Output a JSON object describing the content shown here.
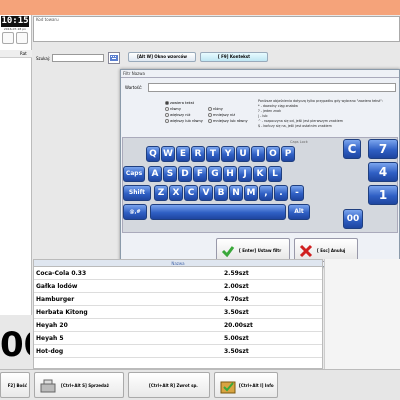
{
  "clock": {
    "time": "10:15",
    "date": "2016-07-18 pn"
  },
  "left_panel": {
    "header_label": "Rat",
    "total_display": "00"
  },
  "kod_towaru_label": "Kod towaru",
  "szukaj_label": "Szukaj:",
  "toolbar": {
    "okno_wzorca": "[Alt W] Okno wzorców",
    "kontekst": "[ F9] Kontekst"
  },
  "dialog": {
    "title": "Filtr Nazwa",
    "wartosc_label": "Wartość:",
    "radio_options": [
      {
        "label": "zawiera tekst",
        "selected": true
      },
      {
        "label": "równy",
        "selected": false
      },
      {
        "label": "większy niż",
        "selected": false
      },
      {
        "label": "większy lub równy",
        "selected": false
      },
      {
        "label": "różny",
        "selected": false
      },
      {
        "label": "mniejszy niż",
        "selected": false
      },
      {
        "label": "mniejszy lub równy",
        "selected": false
      }
    ],
    "hint_lines": [
      "Poniższe objaśnienia dotyczą tylko przypadku gdy wybrano \"zawiera tekst\":",
      "* - dowolny ciąg znaków",
      "? - jeden znak",
      "| - lub",
      "^ - rozpoczyna się od, jeśli jest pierwszym znakiem",
      "$ - kończy się na, jeśli jest ostatnim znakiem"
    ],
    "capslock_label": "Caps Lock",
    "ok_label": "[ Enter] Ustaw filtr",
    "cancel_label": "[ Esc] Anuluj"
  },
  "keyboard": {
    "row1": [
      "Q",
      "W",
      "E",
      "R",
      "T",
      "Y",
      "U",
      "I",
      "O",
      "P"
    ],
    "row2": [
      "A",
      "S",
      "D",
      "F",
      "G",
      "H",
      "J",
      "K",
      "L"
    ],
    "row3": [
      "Z",
      "X",
      "C",
      "V",
      "B",
      "N",
      "M",
      ",",
      "."
    ],
    "caps": "Caps",
    "shift": "Shift",
    "alt": "Alt",
    "special": "@,#",
    "minus": "-",
    "numpad": [
      "C",
      "7",
      "4",
      "1",
      "00"
    ]
  },
  "grid": {
    "column_header": "Nazwa",
    "rows": [
      {
        "name": "Coca-Cola 0.33",
        "qty": "2.59szt"
      },
      {
        "name": "Gałka lodów",
        "qty": "2.00szt"
      },
      {
        "name": "Hamburger",
        "qty": "4.70szt"
      },
      {
        "name": "Herbata Kitong",
        "qty": "3.50szt"
      },
      {
        "name": "Heyah 20",
        "qty": "20.00szt"
      },
      {
        "name": "Heyah 5",
        "qty": "5.00szt"
      },
      {
        "name": "Hot-dog",
        "qty": "3.50szt"
      }
    ]
  },
  "bottom": {
    "b1": "F2] Bość",
    "b2": "[Ctrl+Alt S] Sprzedaż",
    "b3": "[Ctrl+Alt R] Zwrot sp.",
    "b4": "[Ctrl+Alt I] Info"
  },
  "colors": {
    "topbar": "#f5a37a",
    "key_blue": "#2f5fc4",
    "ok_green": "#3aa83a",
    "cancel_red": "#d02020"
  }
}
